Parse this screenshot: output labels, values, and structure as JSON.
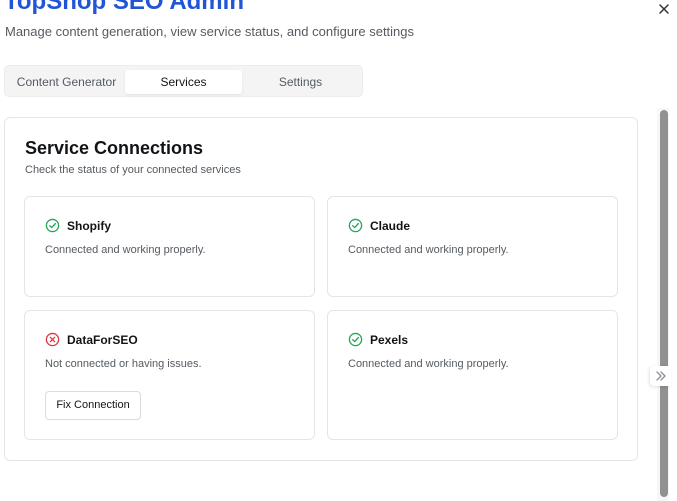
{
  "header": {
    "title": "TopShop SEO Admin",
    "subtitle": "Manage content generation, view service status, and configure settings"
  },
  "tabs": [
    {
      "label": "Content Generator",
      "active": false
    },
    {
      "label": "Services",
      "active": true
    },
    {
      "label": "Settings",
      "active": false
    }
  ],
  "services_panel": {
    "title": "Service Connections",
    "description": "Check the status of your connected services",
    "cards": [
      {
        "name": "Shopify",
        "status": "connected",
        "message": "Connected and working properly.",
        "icon": "check-circle-icon"
      },
      {
        "name": "Claude",
        "status": "connected",
        "message": "Connected and working properly.",
        "icon": "check-circle-icon"
      },
      {
        "name": "DataForSEO",
        "status": "error",
        "message": "Not connected or having issues.",
        "icon": "x-circle-icon",
        "action_label": "Fix Connection"
      },
      {
        "name": "Pexels",
        "status": "connected",
        "message": "Connected and working properly.",
        "icon": "check-circle-icon"
      }
    ]
  },
  "colors": {
    "accent": "#2155d6",
    "success": "#22a55a",
    "error": "#dc3545"
  }
}
